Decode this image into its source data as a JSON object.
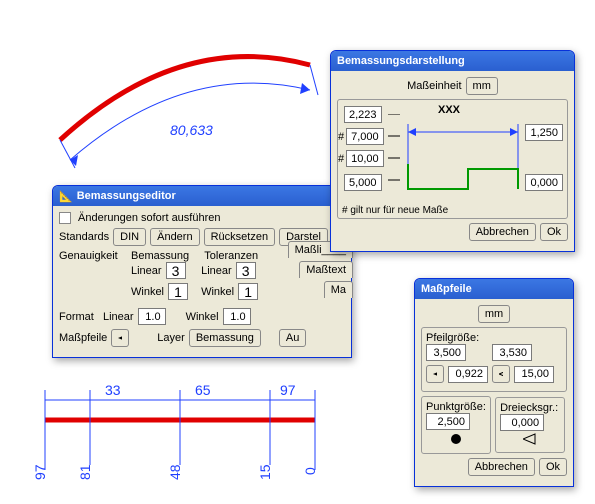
{
  "arc": {
    "dim_value": "80,633"
  },
  "chain": {
    "values_top": [
      "33",
      "65",
      "97"
    ],
    "values_bottom": [
      "97",
      "81",
      "48",
      "15",
      "0"
    ]
  },
  "editor": {
    "title": "Bemassungseditor",
    "chk_label": "Änderungen sofort ausführen",
    "standards_label": "Standards",
    "din_btn": "DIN",
    "aendern_btn": "Ändern",
    "ruecksetzen_btn": "Rücksetzen",
    "darstel_btn": "Darstel",
    "genauigkeit_label": "Genauigkeit",
    "bemassung_label": "Bemassung",
    "toleranzen_label": "Toleranzen",
    "linear_label": "Linear",
    "winkel_label": "Winkel",
    "bem_linear": "3",
    "bem_winkel": "1",
    "tol_linear": "3",
    "tol_winkel": "1",
    "format_label": "Format",
    "fmt_linear": "1.0",
    "fmt_winkel": "1.0",
    "masspfeile_label": "Maßpfeile",
    "layer_label": "Layer",
    "layer_btn": "Bemassung",
    "au_btn": "Au",
    "tab1": "Maßli____",
    "tab2": "Maßtext",
    "tab3": "Ma"
  },
  "darstellung": {
    "title": "Bemassungsdarstellung",
    "masseinheit_label": "Maßeinheit",
    "mm_btn": "mm",
    "v1": "2,223",
    "v2": "7,000",
    "v3": "10,00",
    "v4": "5,000",
    "v5": "1,250",
    "v6": "0,000",
    "xxx": "XXX",
    "hash": "#",
    "note": "# gilt nur für neue Maße",
    "cancel": "Abbrechen",
    "ok": "Ok"
  },
  "masspfeile": {
    "title": "Maßpfeile",
    "mm_btn": "mm",
    "pfeil_label": "Pfeilgröße:",
    "pf1": "3,500",
    "pf2": "3,530",
    "pf3": "0,922",
    "pf4": "15,00",
    "punkt_label": "Punktgröße:",
    "punkt_v": "2,500",
    "dreieck_label": "Dreiecksgr.:",
    "dreieck_v": "0,000",
    "cancel": "Abbrechen",
    "ok": "Ok"
  }
}
